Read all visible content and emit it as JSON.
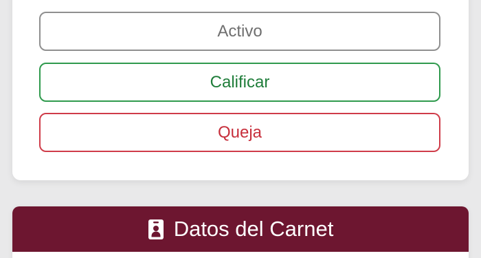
{
  "status_actions": {
    "activo_label": "Activo",
    "calificar_label": "Calificar",
    "queja_label": "Queja"
  },
  "carnet_section": {
    "title": "Datos del Carnet",
    "icon": "id-badge-icon"
  },
  "colors": {
    "activo_border": "#8f8f8f",
    "calificar_green": "#1f7d3a",
    "queja_red": "#c72f3c",
    "carnet_header_bg": "#6d1630"
  }
}
